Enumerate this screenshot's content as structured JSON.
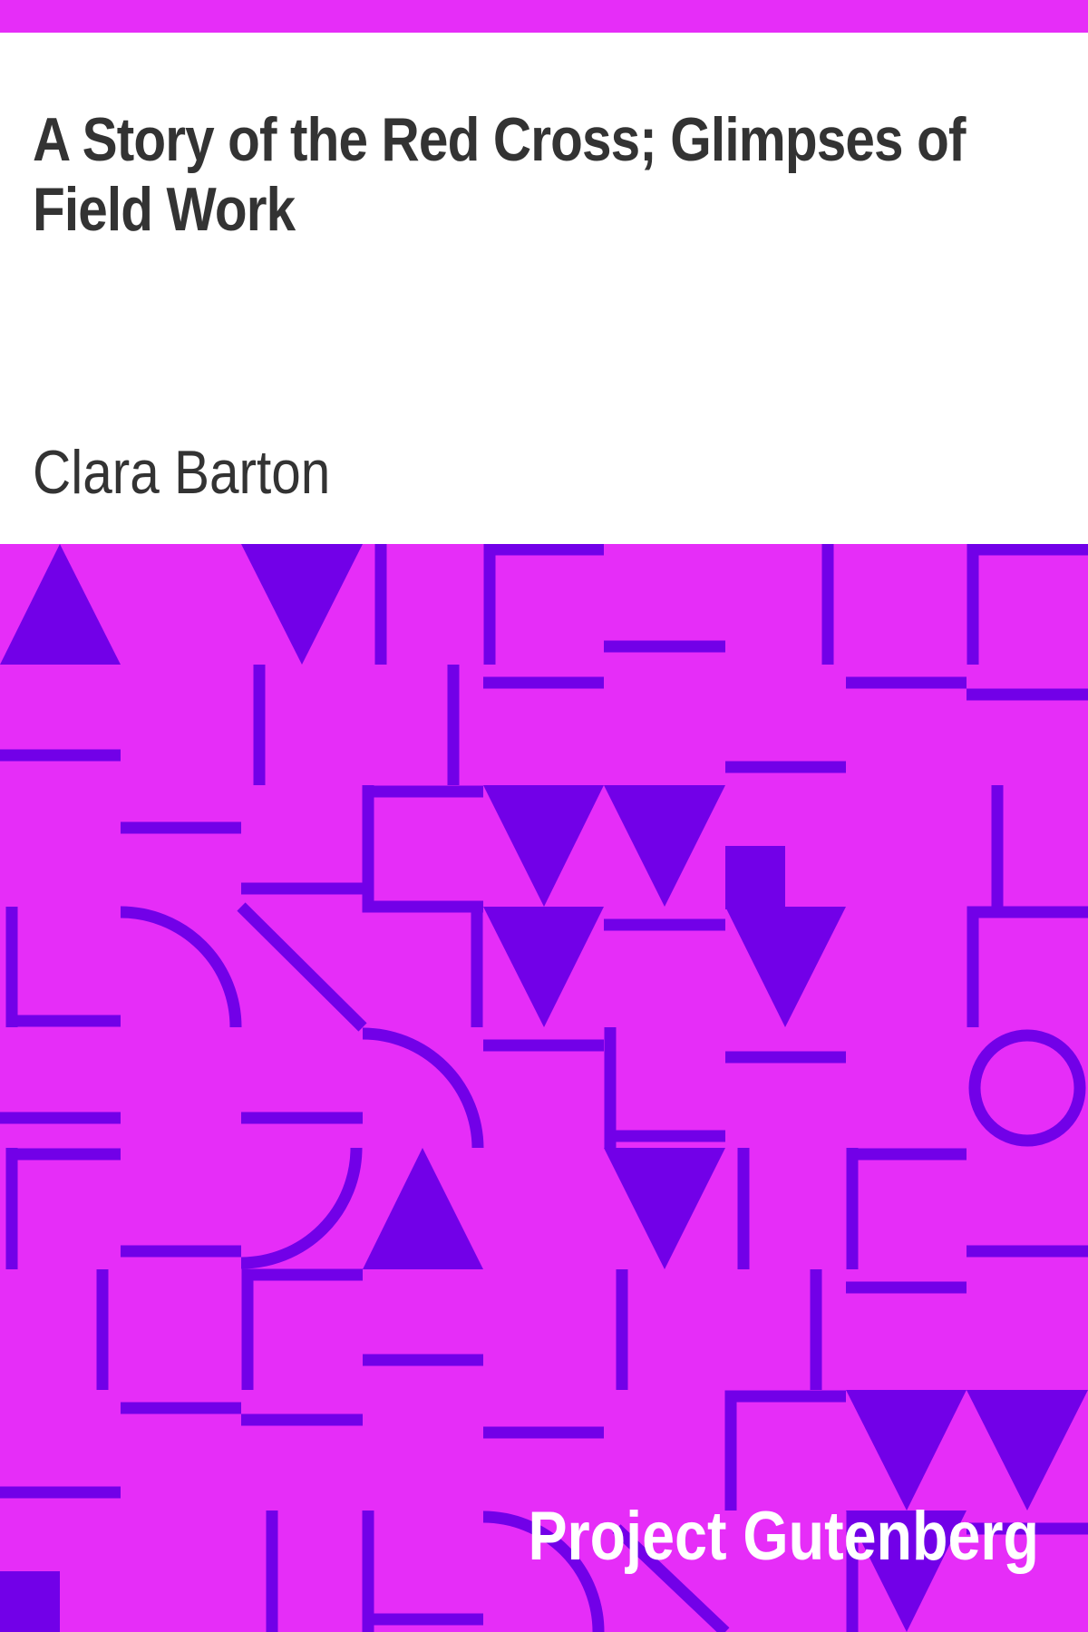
{
  "book": {
    "title": "A Story of the Red Cross; Glimpses of Field Work",
    "author": "Clara Barton",
    "publisher": "Project Gutenberg"
  },
  "colors": {
    "background": "#e62df8",
    "pattern": "#7200e8",
    "panel": "#ffffff",
    "text": "#333333",
    "publisher_text": "#ffffff"
  }
}
